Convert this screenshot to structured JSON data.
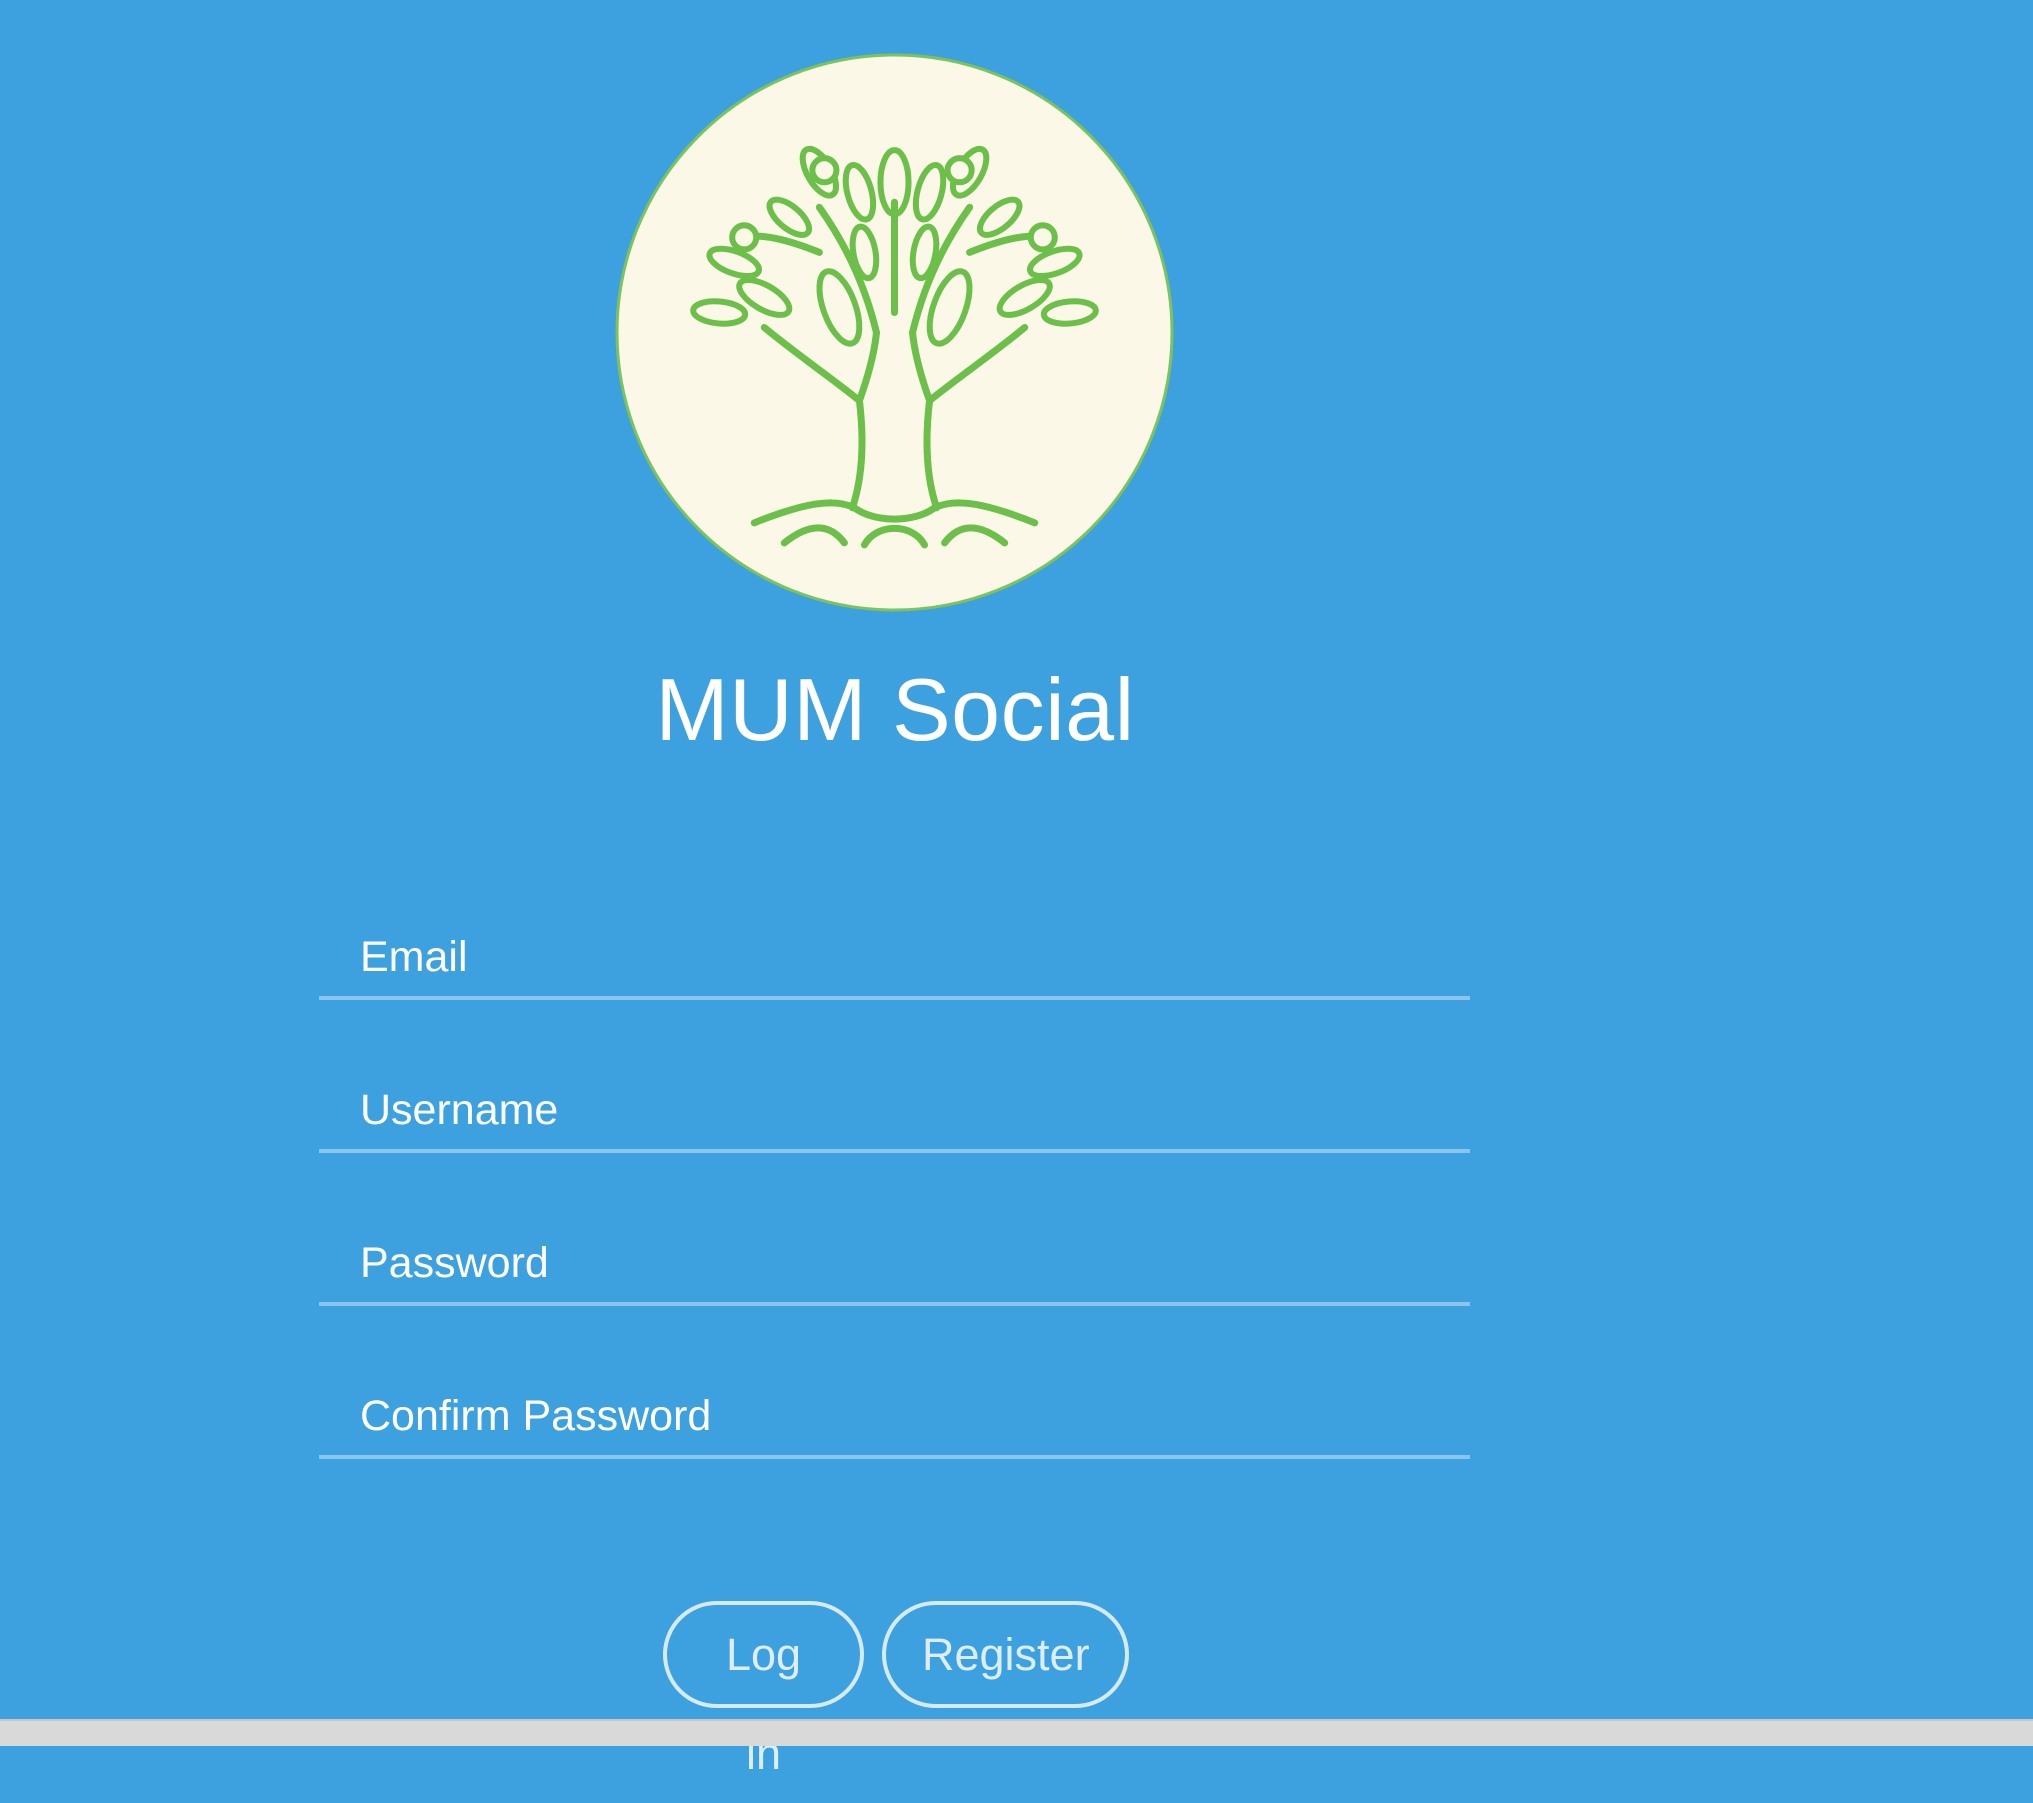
{
  "app": {
    "title": "MUM Social",
    "logo_icon": "tree-of-life-icon"
  },
  "form": {
    "email": {
      "placeholder": "Email",
      "value": ""
    },
    "username": {
      "placeholder": "Username",
      "value": ""
    },
    "password": {
      "placeholder": "Password",
      "value": ""
    },
    "confirm_password": {
      "placeholder": "Confirm Password",
      "value": ""
    }
  },
  "buttons": {
    "login_label": "Log in",
    "register_label": "Register"
  },
  "colors": {
    "background": "#3ea1df",
    "logo_fill": "#fbf8e8",
    "logo_green": "#6cc04a",
    "field_underline": "#8cc4ec",
    "text": "#ffffff"
  }
}
